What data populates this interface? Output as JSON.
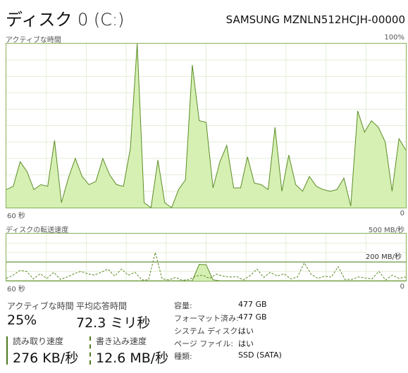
{
  "header": {
    "title": "ディスク 0 (C:)",
    "model": "SAMSUNG MZNLN512HCJH-00000"
  },
  "active_time_graph": {
    "label": "アクティブな時間",
    "max_label": "100%",
    "x_left_label": "60 秒",
    "x_right_label": "0",
    "values_pct": [
      11,
      13,
      28,
      22,
      11,
      14,
      13,
      41,
      3,
      18,
      30,
      19,
      14,
      16,
      30,
      20,
      14,
      13,
      36,
      100,
      3,
      0,
      29,
      3,
      0,
      11,
      17,
      87,
      53,
      52,
      12,
      28,
      38,
      12,
      12,
      31,
      15,
      14,
      11,
      49,
      10,
      32,
      14,
      10,
      19,
      13,
      11,
      10,
      11,
      18,
      1,
      59,
      46,
      53,
      49,
      40,
      10,
      42,
      35
    ]
  },
  "transfer_graph": {
    "label": "ディスクの転送速度",
    "max_label": "500 MB/秒",
    "ref_label": "200 MB/秒",
    "ref_pct": 40,
    "x_left_label": "60 秒",
    "x_right_label": "0",
    "read_pct": [
      0,
      0,
      0,
      0,
      0,
      0,
      0,
      0,
      0,
      0,
      0,
      0,
      0,
      0,
      0,
      0,
      0,
      0,
      0,
      0,
      0,
      0,
      0,
      0,
      0,
      0,
      0,
      0,
      35,
      34,
      2,
      0,
      0,
      0,
      0,
      0,
      0,
      0,
      0,
      0,
      0,
      0,
      0,
      0,
      0,
      0,
      0,
      0,
      0,
      0,
      0,
      0,
      0,
      0,
      0,
      0,
      0,
      0,
      0
    ],
    "write_pct": [
      5,
      12,
      22,
      20,
      4,
      15,
      5,
      18,
      3,
      8,
      15,
      20,
      15,
      12,
      18,
      25,
      10,
      25,
      12,
      18,
      2,
      2,
      60,
      4,
      2,
      7,
      1,
      3,
      10,
      12,
      5,
      14,
      10,
      8,
      9,
      2,
      11,
      25,
      7,
      18,
      10,
      15,
      4,
      8,
      38,
      14,
      5,
      10,
      8,
      30,
      3,
      3,
      8,
      6,
      4,
      20,
      2,
      12,
      5,
      8
    ]
  },
  "stats": {
    "active_label": "アクティブな時間",
    "active_value": "25%",
    "response_label": "平均応答時間",
    "response_value": "72.3 ミリ秒",
    "read_label": "読み取り速度",
    "read_value": "276 KB/秒",
    "write_label": "書き込み速度",
    "write_value": "12.6 MB/秒"
  },
  "properties": [
    {
      "key": "容量:",
      "value": "477 GB"
    },
    {
      "key": "フォーマット済み:",
      "value": "477 GB"
    },
    {
      "key": "システム ディスク:",
      "value": "はい"
    },
    {
      "key": "ページ ファイル:",
      "value": "はい"
    },
    {
      "key": "種類:",
      "value": "SSD (SATA)"
    }
  ],
  "colors": {
    "graph_line": "#5b8c24",
    "graph_fill": "#d6f0b4",
    "graph_border": "#86b05a",
    "grid": "#e3eed6"
  }
}
